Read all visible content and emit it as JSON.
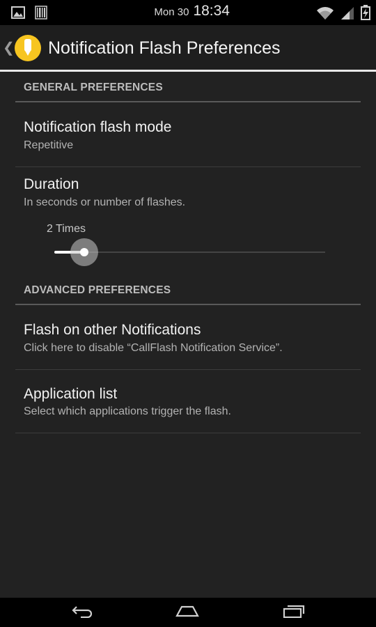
{
  "status_bar": {
    "date": "Mon 30",
    "time": "18:34",
    "left_icons": [
      "gallery-icon",
      "barcode-icon"
    ],
    "right_icons": [
      "wifi-icon",
      "cell-signal-icon",
      "battery-charging-icon"
    ]
  },
  "action_bar": {
    "title": "Notification Flash Preferences",
    "app_icon": "callflash-app-icon",
    "accent_color": "#f7c520"
  },
  "sections": {
    "general": {
      "header": "GENERAL PREFERENCES",
      "items": [
        {
          "title": "Notification flash mode",
          "summary": "Repetitive"
        },
        {
          "title": "Duration",
          "summary": "In seconds or number of flashes."
        }
      ],
      "slider": {
        "value_label": "2 Times",
        "level_fraction": 0.11
      }
    },
    "advanced": {
      "header": "ADVANCED PREFERENCES",
      "items": [
        {
          "title": "Flash on other Notifications",
          "summary": "Click here to disable “CallFlash Notification Service”."
        },
        {
          "title": "Application list",
          "summary": "Select which applications trigger the flash."
        }
      ]
    }
  },
  "nav_bar": {
    "buttons": [
      "back-icon",
      "home-icon",
      "recent-apps-icon"
    ]
  }
}
